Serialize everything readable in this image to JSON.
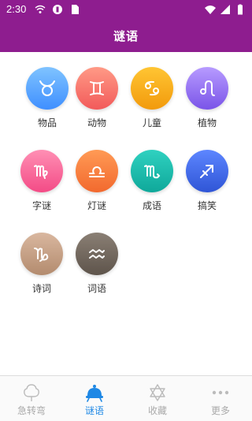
{
  "status": {
    "time": "2:30"
  },
  "header": {
    "title": "谜语"
  },
  "categories": [
    {
      "label": "物品",
      "icon": "taurus-icon",
      "color_top": "#7fc3ff",
      "color_bottom": "#3f8fff"
    },
    {
      "label": "动物",
      "icon": "gemini-icon",
      "color_top": "#ff9a86",
      "color_bottom": "#f25a5a"
    },
    {
      "label": "儿童",
      "icon": "cancer-icon",
      "color_top": "#ffc533",
      "color_bottom": "#f29a0c"
    },
    {
      "label": "植物",
      "icon": "leo-icon",
      "color_top": "#b79bff",
      "color_bottom": "#7a54e8"
    },
    {
      "label": "字谜",
      "icon": "virgo-icon",
      "color_top": "#ff8fb4",
      "color_bottom": "#f34b86"
    },
    {
      "label": "灯谜",
      "icon": "libra-icon",
      "color_top": "#ff9a55",
      "color_bottom": "#f2692e"
    },
    {
      "label": "成语",
      "icon": "scorpio-icon",
      "color_top": "#2fd1c0",
      "color_bottom": "#0fa89a"
    },
    {
      "label": "搞笑",
      "icon": "sagittarius-icon",
      "color_top": "#5d86ff",
      "color_bottom": "#2f55d6"
    },
    {
      "label": "诗词",
      "icon": "capricorn-icon",
      "color_top": "#d9b79f",
      "color_bottom": "#b38b6e"
    },
    {
      "label": "词语",
      "icon": "aquarius-icon",
      "color_top": "#8a7f74",
      "color_bottom": "#5e544b"
    }
  ],
  "bottom_nav": [
    {
      "label": "急转弯",
      "icon": "tree-icon",
      "active": false
    },
    {
      "label": "谜语",
      "icon": "hat-icon",
      "active": true
    },
    {
      "label": "收藏",
      "icon": "star-of-david-icon",
      "active": false
    },
    {
      "label": "更多",
      "icon": "more-dots-icon",
      "active": false
    }
  ],
  "colors": {
    "header": "#8e1d8f",
    "active_nav": "#1e88e5",
    "inactive_nav": "#aaaaaa"
  }
}
